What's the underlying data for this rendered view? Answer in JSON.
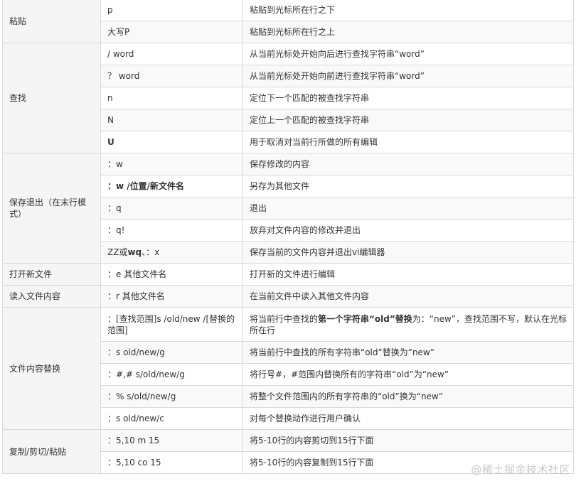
{
  "groups": [
    {
      "name": "粘贴",
      "rows": [
        {
          "cmd": "p",
          "desc": "粘贴到光标所在行之下"
        },
        {
          "cmd": "大写P",
          "desc": "粘贴到光标所在行之上"
        }
      ]
    },
    {
      "name": "查找",
      "rows": [
        {
          "cmd": "/ word",
          "desc": "从当前光标处开始向后进行查找字符串“word”"
        },
        {
          "cmd": "？ word",
          "desc": "从当前光标处开始向前进行查找字符串“word”"
        },
        {
          "cmd": "n",
          "desc": "定位下一个匹配的被查找字符串"
        },
        {
          "cmd": "N",
          "desc": "定位上一个匹配的被查找字符串"
        },
        {
          "cmd": "U",
          "desc": "用于取消对当前行所做的所有编辑",
          "bold_cmd": true
        }
      ]
    },
    {
      "name": "保存退出（在末行模式）",
      "rows": [
        {
          "cmd": "：w",
          "desc": "保存修改的内容"
        },
        {
          "cmd": "：w /位置/新文件名",
          "desc": "另存为其他文件",
          "bold_cmd": true
        },
        {
          "cmd": "：q",
          "desc": "退出"
        },
        {
          "cmd": "：q!",
          "desc": "放弃对文件内容的修改并退出"
        },
        {
          "cmd_pre": "ZZ或",
          "cmd_bold": "wq",
          "cmd_post": "、：x",
          "desc": "保存当前的文件内容并退出vi编辑器"
        }
      ]
    },
    {
      "name": "打开新文件",
      "rows": [
        {
          "cmd": "：e 其他文件名",
          "desc": "打开新的文件进行编辑"
        }
      ]
    },
    {
      "name": "读入文件内容",
      "rows": [
        {
          "cmd": "：r 其他文件名",
          "desc": "在当前文件中读入其他文件内容"
        }
      ]
    },
    {
      "name": "文件内容替换",
      "rows": [
        {
          "cmd": "：[查找范围]s /old/new /[替换的范围]",
          "desc_pre": "将当前行中查找的",
          "desc_bold": "第一个字符串“old”替换",
          "desc_post": "为：“new”，查找范围不写，默认在光标所在行",
          "tall": true
        },
        {
          "cmd": "：s old/new/g",
          "desc": "将当前行中查找的所有字符串“old”替换为“new”"
        },
        {
          "cmd": "：#,# s/old/new/g",
          "desc": "将行号#，#范围内替换所有的字符串“old”为“new”"
        },
        {
          "cmd": "：% s/old/new/g",
          "desc": "将整个文件范围内的所有字符串的“old”换为“new”"
        },
        {
          "cmd": "：s old/new/c",
          "desc": "对每个替换动作进行用户确认"
        }
      ]
    },
    {
      "name": "复制/剪切/粘贴",
      "rows": [
        {
          "cmd": "：5,10 m 15",
          "desc": "将5-10行的内容剪切到15行下面"
        },
        {
          "cmd": "：5,10 co 15",
          "desc": "将5-10行的内容复制到15行下面"
        }
      ]
    }
  ],
  "watermark": "@稀土掘金技术社区"
}
